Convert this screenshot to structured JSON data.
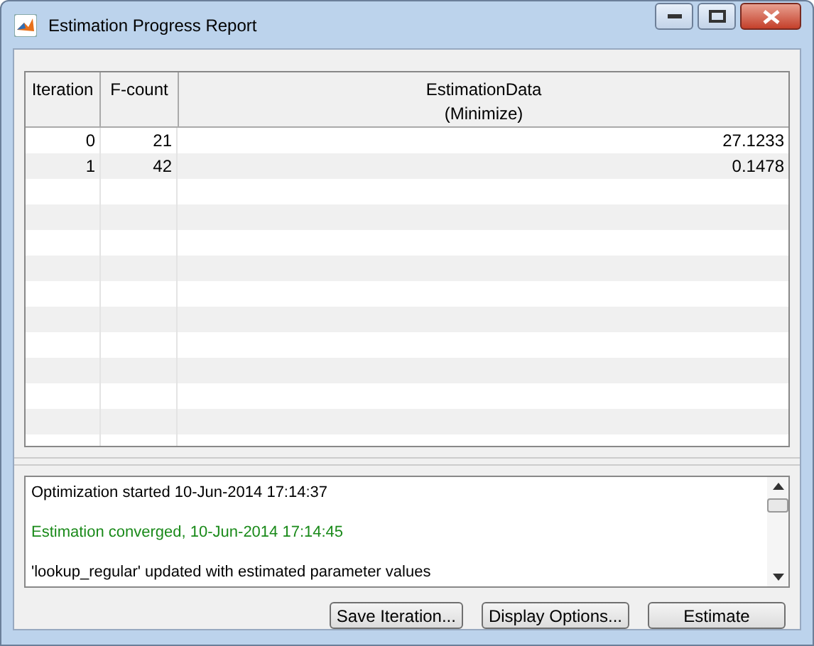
{
  "window": {
    "title": "Estimation Progress Report"
  },
  "table": {
    "columns": [
      "Iteration",
      "F-count",
      "EstimationData\n(Minimize)"
    ],
    "rows": [
      [
        "0",
        "21",
        "27.1233"
      ],
      [
        "1",
        "42",
        "0.1478"
      ]
    ]
  },
  "log": [
    {
      "kind": "normal",
      "text": "Optimization started 10-Jun-2014 17:14:37"
    },
    {
      "kind": "success",
      "text": "Estimation converged, 10-Jun-2014 17:14:45"
    },
    {
      "kind": "normal",
      "text": "'lookup_regular' updated with estimated parameter values"
    }
  ],
  "buttons": [
    {
      "label": "Save Iteration...",
      "kind": "small"
    },
    {
      "label": "Display Options...",
      "kind": "small"
    },
    {
      "label": "Estimate",
      "kind": "wide"
    }
  ]
}
